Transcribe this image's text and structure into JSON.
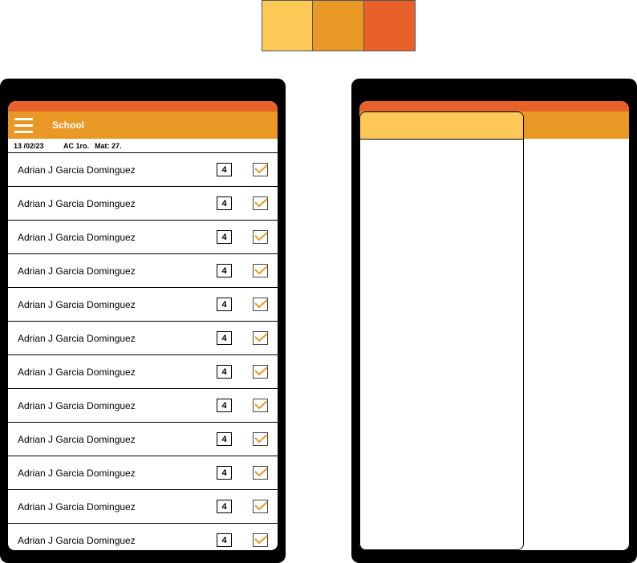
{
  "colors": {
    "light_orange": "#FDC956",
    "orange": "#E99826",
    "dark_orange": "#E8612A"
  },
  "palette": [
    "#FDC956",
    "#E99826",
    "#E8612A"
  ],
  "app": {
    "title": "School",
    "menu_icon": "hamburger-icon"
  },
  "info": {
    "date": "13 /02/23",
    "course": "AC 1ro.",
    "subject": "Mat: 27."
  },
  "students": [
    {
      "name": "Adrian J Garcia Dominguez",
      "grade": "4",
      "checked": true
    },
    {
      "name": "Adrian J Garcia Dominguez",
      "grade": "4",
      "checked": true
    },
    {
      "name": "Adrian J Garcia Dominguez",
      "grade": "4",
      "checked": true
    },
    {
      "name": "Adrian J Garcia Dominguez",
      "grade": "4",
      "checked": true
    },
    {
      "name": "Adrian J Garcia Dominguez",
      "grade": "4",
      "checked": true
    },
    {
      "name": "Adrian J Garcia Dominguez",
      "grade": "4",
      "checked": true
    },
    {
      "name": "Adrian J Garcia Dominguez",
      "grade": "4",
      "checked": true
    },
    {
      "name": "Adrian J Garcia Dominguez",
      "grade": "4",
      "checked": true
    },
    {
      "name": "Adrian J Garcia Dominguez",
      "grade": "4",
      "checked": true
    },
    {
      "name": "Adrian J Garcia Dominguez",
      "grade": "4",
      "checked": true
    },
    {
      "name": "Adrian J Garcia Dominguez",
      "grade": "4",
      "checked": true
    },
    {
      "name": "Adrian J Garcia Dominguez",
      "grade": "4",
      "checked": true
    }
  ]
}
